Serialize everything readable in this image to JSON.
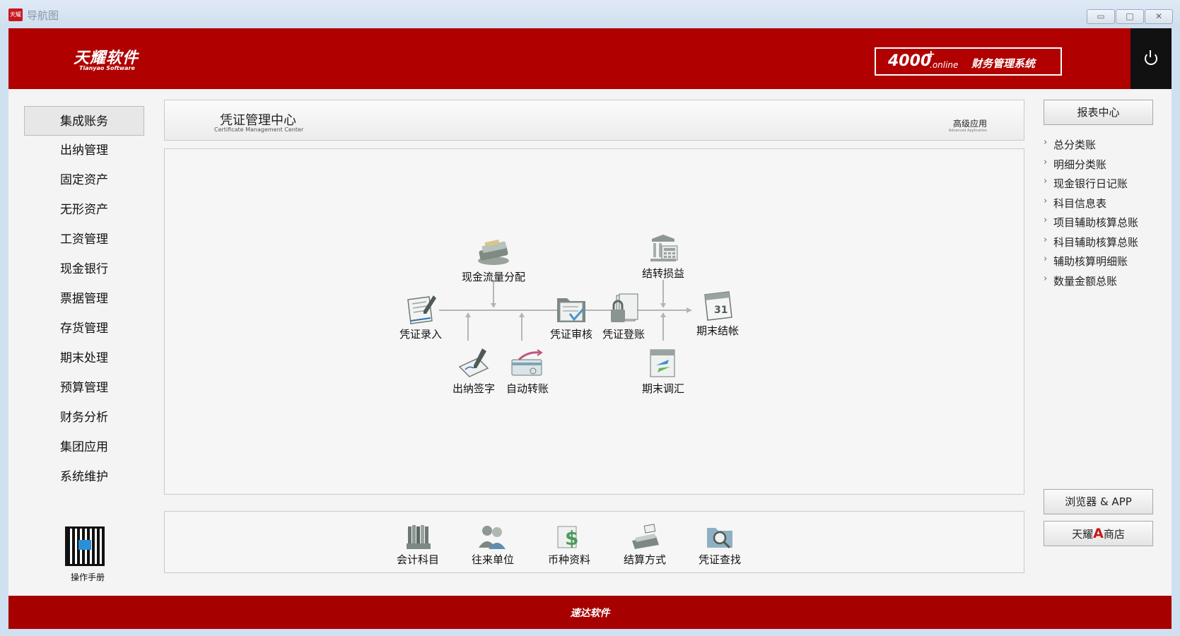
{
  "window": {
    "title": "导航图",
    "app_icon_text": "天耀",
    "minimize": "▭",
    "maximize": "□",
    "close": "✕"
  },
  "header": {
    "logo_cn": "天耀软件",
    "logo_en": "Tianyao Software",
    "product_num": "4000",
    "product_plus": "+",
    "product_online": ".online",
    "product_name": "财务管理系统",
    "power_icon": "power-icon",
    "colors": {
      "header_bg": "#b00000",
      "power_bg": "#111111"
    }
  },
  "sidebar": {
    "items": [
      {
        "label": "集成账务",
        "active": true
      },
      {
        "label": "出纳管理"
      },
      {
        "label": "固定资产"
      },
      {
        "label": "无形资产"
      },
      {
        "label": "工资管理"
      },
      {
        "label": "现金银行"
      },
      {
        "label": "票据管理"
      },
      {
        "label": "存货管理"
      },
      {
        "label": "期末处理"
      },
      {
        "label": "预算管理"
      },
      {
        "label": "财务分析"
      },
      {
        "label": "集团应用"
      },
      {
        "label": "系统维护"
      }
    ],
    "qr_label": "操作手册"
  },
  "panel": {
    "title": "凭证管理中心",
    "subtitle": "Certificate Management Center",
    "advanced": "高级应用",
    "advanced_sub": "Advanced Application"
  },
  "flow": {
    "nodes": {
      "cash_flow": "现金流量分配",
      "carry_profit": "结转损益",
      "entry": "凭证录入",
      "audit": "凭证审核",
      "post": "凭证登账",
      "close_period": "期末结帐",
      "cashier_sign": "出纳签字",
      "auto_transfer": "自动转账",
      "period_adjust": "期末调汇"
    }
  },
  "tools": {
    "items": [
      "会计科目",
      "往来单位",
      "币种资料",
      "结算方式",
      "凭证查找"
    ]
  },
  "right": {
    "report_center": "报表中心",
    "links": [
      "总分类账",
      "明细分类账",
      "现金银行日记账",
      "科目信息表",
      "项目辅助核算总账",
      "科目辅助核算总账",
      "辅助核算明细账",
      "数量金额总账"
    ],
    "browser_app": "浏览器 & APP",
    "store_prefix": "天耀",
    "store_a": "A",
    "store_suffix": "商店"
  },
  "footer": {
    "text": "速达软件"
  }
}
